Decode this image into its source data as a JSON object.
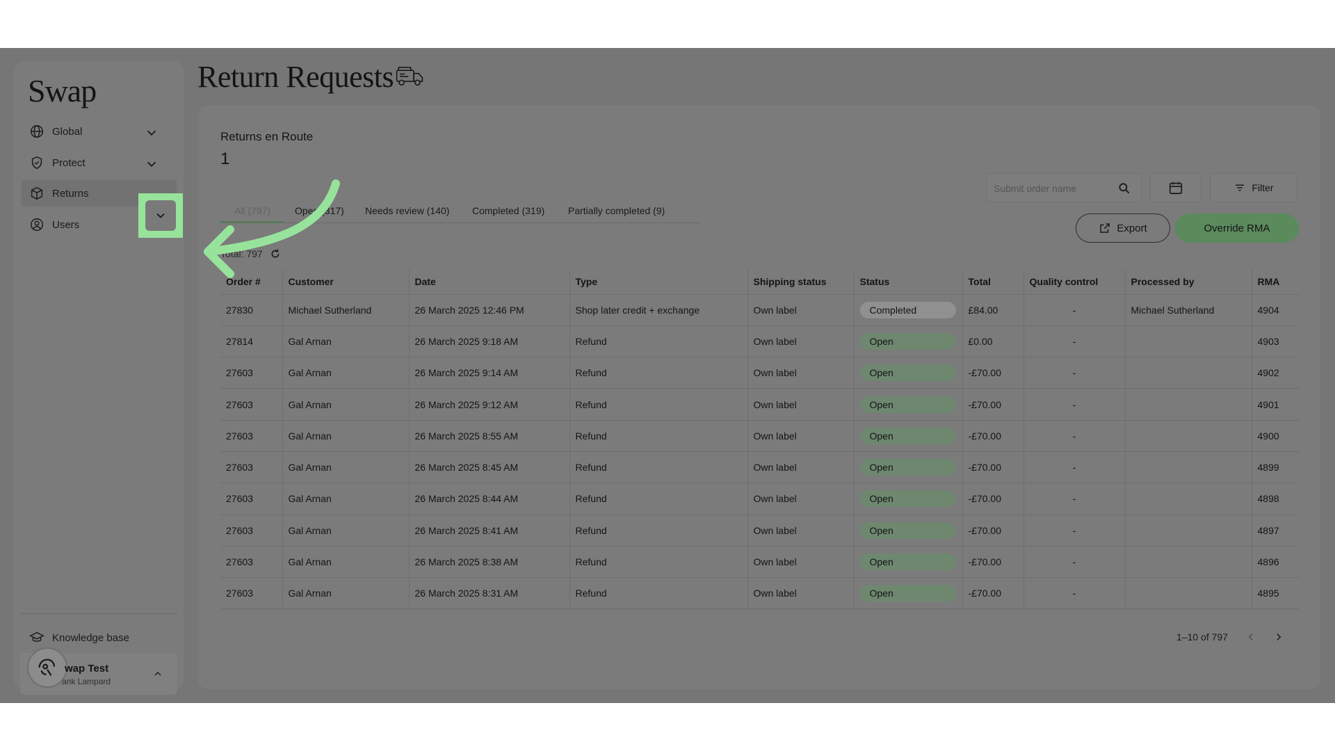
{
  "sidebar": {
    "logo": "Swap",
    "items": [
      {
        "label": "Global",
        "icon": "globe-icon",
        "has_chevron": true
      },
      {
        "label": "Protect",
        "icon": "shield-icon",
        "has_chevron": true
      },
      {
        "label": "Returns",
        "icon": "box-icon",
        "has_chevron": true,
        "active": true
      },
      {
        "label": "Users",
        "icon": "user-circle-icon",
        "has_chevron": false
      }
    ],
    "knowledge_base": "Knowledge base",
    "user": {
      "name": "wap Test",
      "sub": "ank Lampard"
    }
  },
  "header": {
    "title": "Return Requests",
    "icon": "delivery-van-icon"
  },
  "main": {
    "route_label": "Returns en Route",
    "route_count": "1",
    "tabs": [
      {
        "label": "All (797)",
        "active": true
      },
      {
        "label": "Open (317)"
      },
      {
        "label": "Needs review (140)"
      },
      {
        "label": "Completed (319)"
      },
      {
        "label": "Partially completed (9)"
      }
    ],
    "total": "Total: 797",
    "search": {
      "placeholder": "Submit order name"
    },
    "filter_label": "Filter",
    "export_label": "Export",
    "override_label": "Override RMA",
    "columns": [
      "Order #",
      "Customer",
      "Date",
      "Type",
      "Shipping status",
      "Status",
      "Total",
      "Quality control",
      "Processed by",
      "RMA"
    ],
    "rows": [
      {
        "order": "27830",
        "customer": "Michael Sutherland",
        "date": "26 March 2025 12:46 PM",
        "type": "Shop later credit + exchange",
        "shipping": "Own label",
        "status": "Completed",
        "total": "£84.00",
        "qc": "-",
        "processed_by": "Michael Sutherland",
        "rma": "4904"
      },
      {
        "order": "27814",
        "customer": "Gal Arnan",
        "date": "26 March 2025 9:18 AM",
        "type": "Refund",
        "shipping": "Own label",
        "status": "Open",
        "total": "£0.00",
        "qc": "-",
        "processed_by": "",
        "rma": "4903"
      },
      {
        "order": "27603",
        "customer": "Gal Arnan",
        "date": "26 March 2025 9:14 AM",
        "type": "Refund",
        "shipping": "Own label",
        "status": "Open",
        "total": "-£70.00",
        "qc": "-",
        "processed_by": "",
        "rma": "4902"
      },
      {
        "order": "27603",
        "customer": "Gal Arnan",
        "date": "26 March 2025 9:12 AM",
        "type": "Refund",
        "shipping": "Own label",
        "status": "Open",
        "total": "-£70.00",
        "qc": "-",
        "processed_by": "",
        "rma": "4901"
      },
      {
        "order": "27603",
        "customer": "Gal Arnan",
        "date": "26 March 2025 8:55 AM",
        "type": "Refund",
        "shipping": "Own label",
        "status": "Open",
        "total": "-£70.00",
        "qc": "-",
        "processed_by": "",
        "rma": "4900"
      },
      {
        "order": "27603",
        "customer": "Gal Arnan",
        "date": "26 March 2025 8:45 AM",
        "type": "Refund",
        "shipping": "Own label",
        "status": "Open",
        "total": "-£70.00",
        "qc": "-",
        "processed_by": "",
        "rma": "4899"
      },
      {
        "order": "27603",
        "customer": "Gal Arnan",
        "date": "26 March 2025 8:44 AM",
        "type": "Refund",
        "shipping": "Own label",
        "status": "Open",
        "total": "-£70.00",
        "qc": "-",
        "processed_by": "",
        "rma": "4898"
      },
      {
        "order": "27603",
        "customer": "Gal Arnan",
        "date": "26 March 2025 8:41 AM",
        "type": "Refund",
        "shipping": "Own label",
        "status": "Open",
        "total": "-£70.00",
        "qc": "-",
        "processed_by": "",
        "rma": "4897"
      },
      {
        "order": "27603",
        "customer": "Gal Arnan",
        "date": "26 March 2025 8:38 AM",
        "type": "Refund",
        "shipping": "Own label",
        "status": "Open",
        "total": "-£70.00",
        "qc": "-",
        "processed_by": "",
        "rma": "4896"
      },
      {
        "order": "27603",
        "customer": "Gal Arnan",
        "date": "26 March 2025 8:31 AM",
        "type": "Refund",
        "shipping": "Own label",
        "status": "Open",
        "total": "-£70.00",
        "qc": "-",
        "processed_by": "",
        "rma": "4895"
      }
    ],
    "pagination": "1–10 of 797"
  },
  "colors": {
    "overlay": "#767676",
    "highlight": "#97e39b",
    "override_button": "#5b8a5d",
    "status_open": "#6e886f",
    "status_completed": "#909090"
  }
}
